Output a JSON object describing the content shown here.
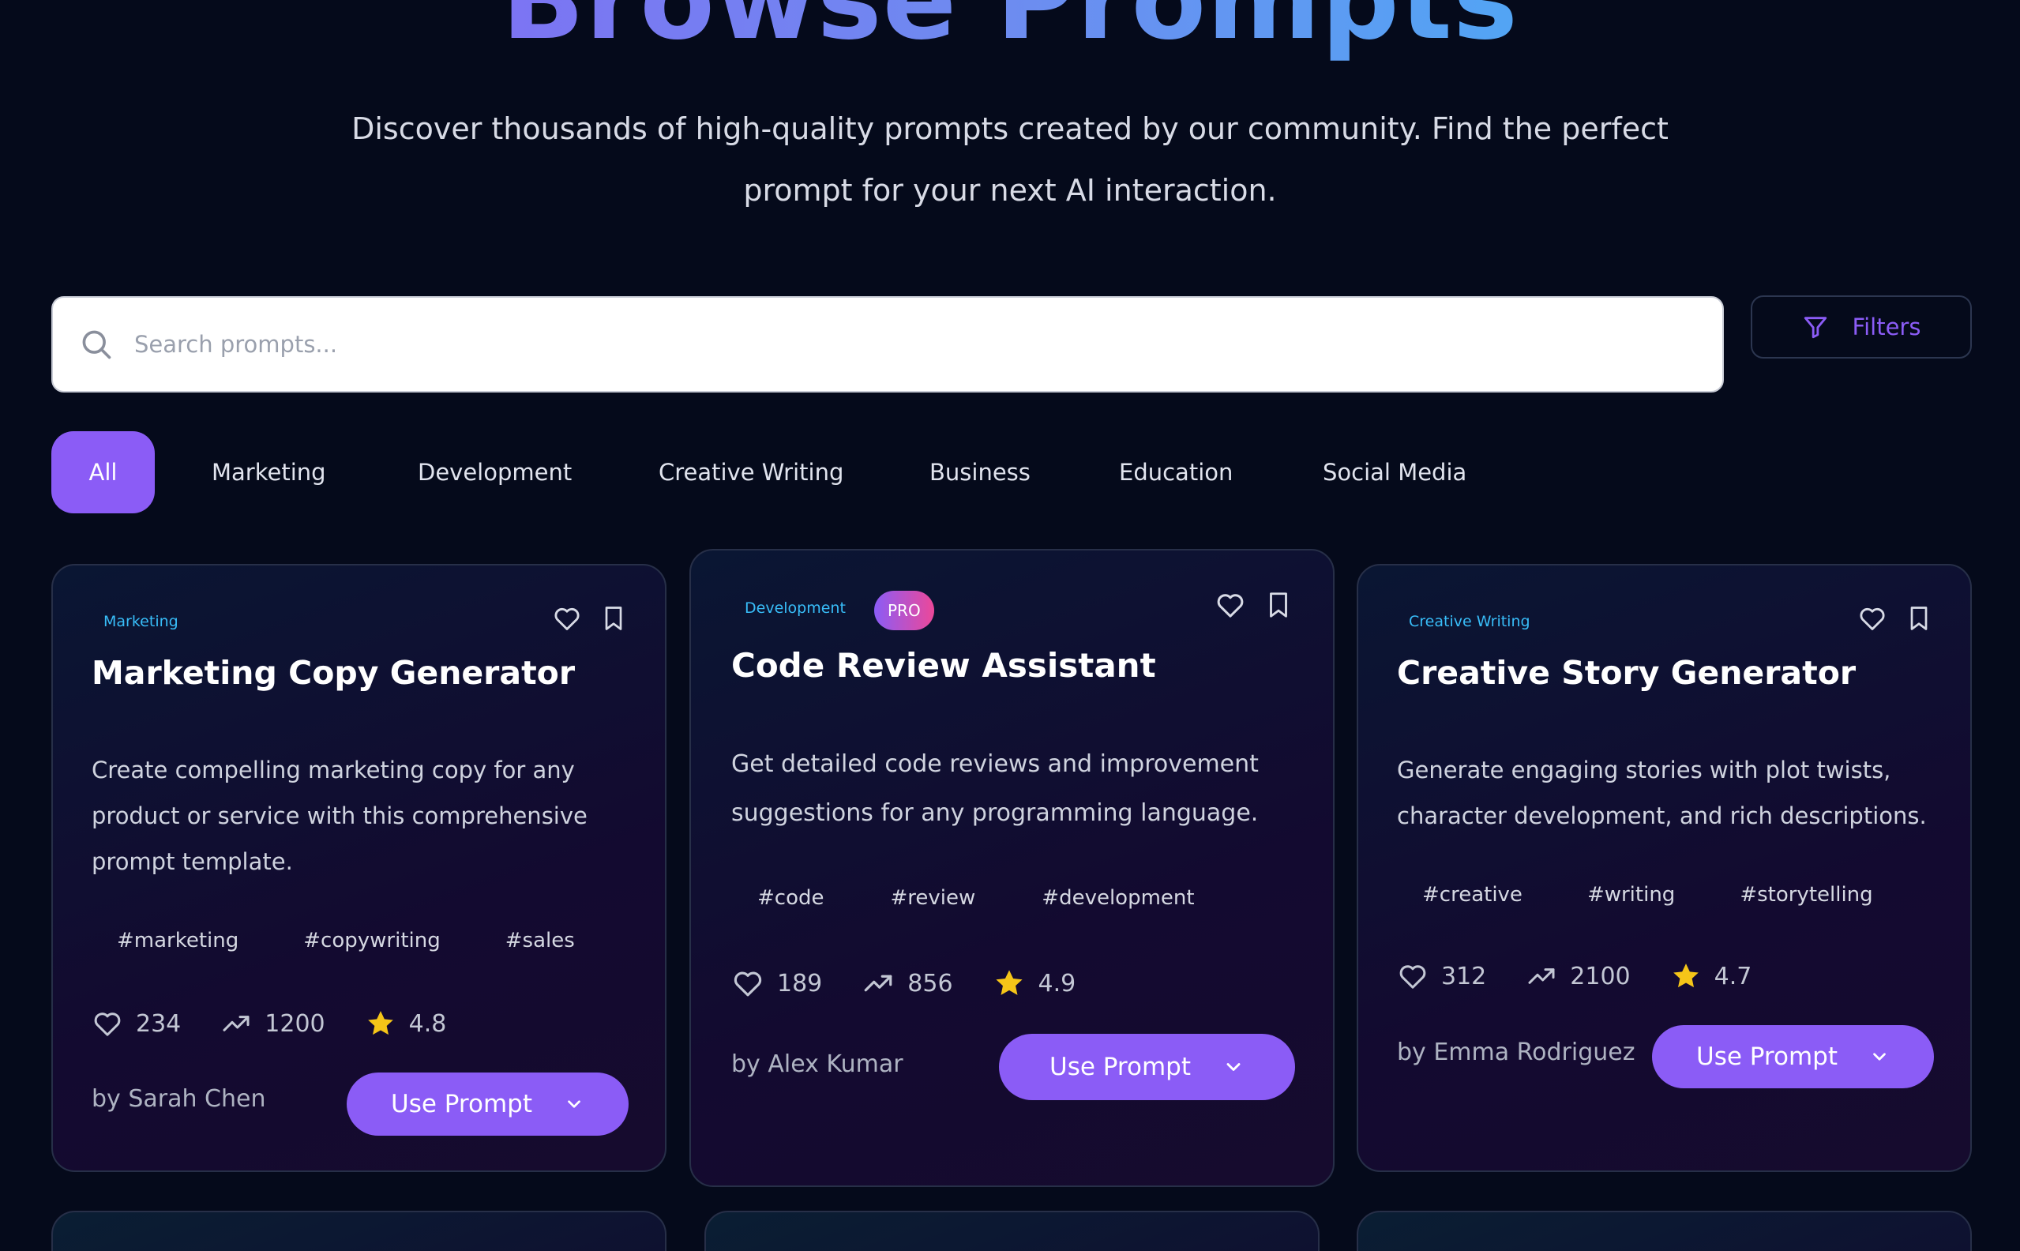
{
  "hero": {
    "title": "Browse Prompts",
    "subtitle": "Discover thousands of high-quality prompts created by our community. Find the perfect prompt for your next AI interaction."
  },
  "search": {
    "placeholder": "Search prompts..."
  },
  "filters": {
    "label": "Filters"
  },
  "categories": [
    "All",
    "Marketing",
    "Development",
    "Creative Writing",
    "Business",
    "Education",
    "Social Media"
  ],
  "active_category": "All",
  "colors": {
    "accent": "#8b5cf6",
    "category_text": "#38bdf8",
    "star": "#f5c518",
    "background": "#050a1b"
  },
  "cards": [
    {
      "category": "Marketing",
      "title": "Marketing Copy Generator",
      "description": "Create compelling marketing copy for any product or service with this comprehensive prompt template.",
      "tags": [
        "#marketing",
        "#copywriting",
        "#sales"
      ],
      "likes": "234",
      "uses": "1200",
      "rating": "4.8",
      "author": "by Sarah Chen",
      "button": "Use Prompt"
    },
    {
      "category": "Development",
      "badge": "PRO",
      "title": "Code Review Assistant",
      "description": "Get detailed code reviews and improvement suggestions for any programming language.",
      "tags": [
        "#code",
        "#review",
        "#development"
      ],
      "likes": "189",
      "uses": "856",
      "rating": "4.9",
      "author": "by Alex Kumar",
      "button": "Use Prompt"
    },
    {
      "category": "Creative Writing",
      "title": "Creative Story Generator",
      "description": "Generate engaging stories with plot twists, character development, and rich descriptions.",
      "tags": [
        "#creative",
        "#writing",
        "#storytelling"
      ],
      "likes": "312",
      "uses": "2100",
      "rating": "4.7",
      "author": "by Emma Rodriguez",
      "button": "Use Prompt"
    }
  ]
}
